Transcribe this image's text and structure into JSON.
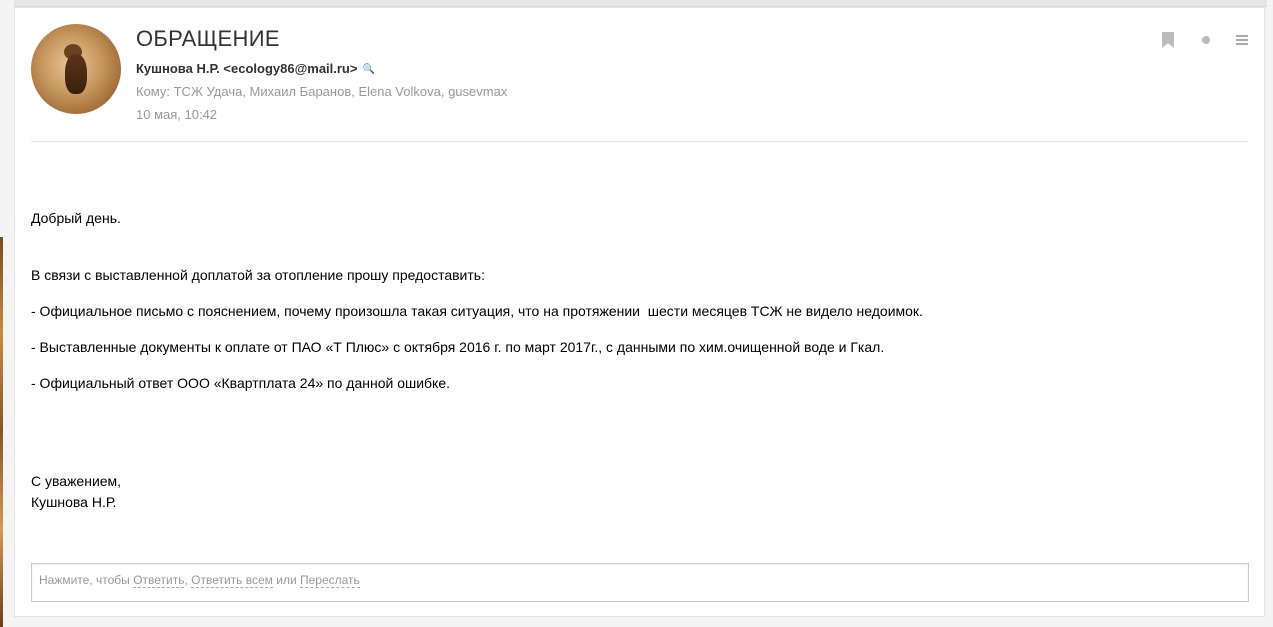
{
  "message": {
    "subject": "ОБРАЩЕНИЕ",
    "from": "Кушнова Н.Р. <ecology86@mail.ru>",
    "to": "Кому: ТСЖ Удача, Михаил Баранов, Elena Volkova, gusevmax",
    "date": "10 мая, 10:42",
    "body": {
      "greeting": "Добрый день.",
      "intro": "В связи с выставленной доплатой за отопление прошу предоставить:",
      "items": [
        "- Официальное письмо с пояснением, почему произошла такая ситуация, что на протяжении  шести месяцев ТСЖ не видело недоимок.",
        "- Выставленные документы к оплате от ПАО «Т Плюс» с октября 2016 г. по март 2017г., с данными по хим.очищенной воде и Гкал.",
        "- Официальный ответ ООО «Квартплата 24» по данной ошибке."
      ],
      "closing": "С уважением,",
      "signature": "Кушнова Н.Р."
    }
  },
  "icons": {
    "bookmark": "bookmark-icon",
    "status_dot": "dot-icon",
    "menu": "menu-icon",
    "search": "search-icon"
  },
  "reply": {
    "prefix": "Нажмите, чтобы ",
    "reply_label": "Ответить",
    "separator": ", ",
    "reply_all_label": "Ответить всем",
    "or_text": " или ",
    "forward_label": "Переслать"
  },
  "colors": {
    "meta_text": "#999999",
    "subject_text": "#333333"
  }
}
